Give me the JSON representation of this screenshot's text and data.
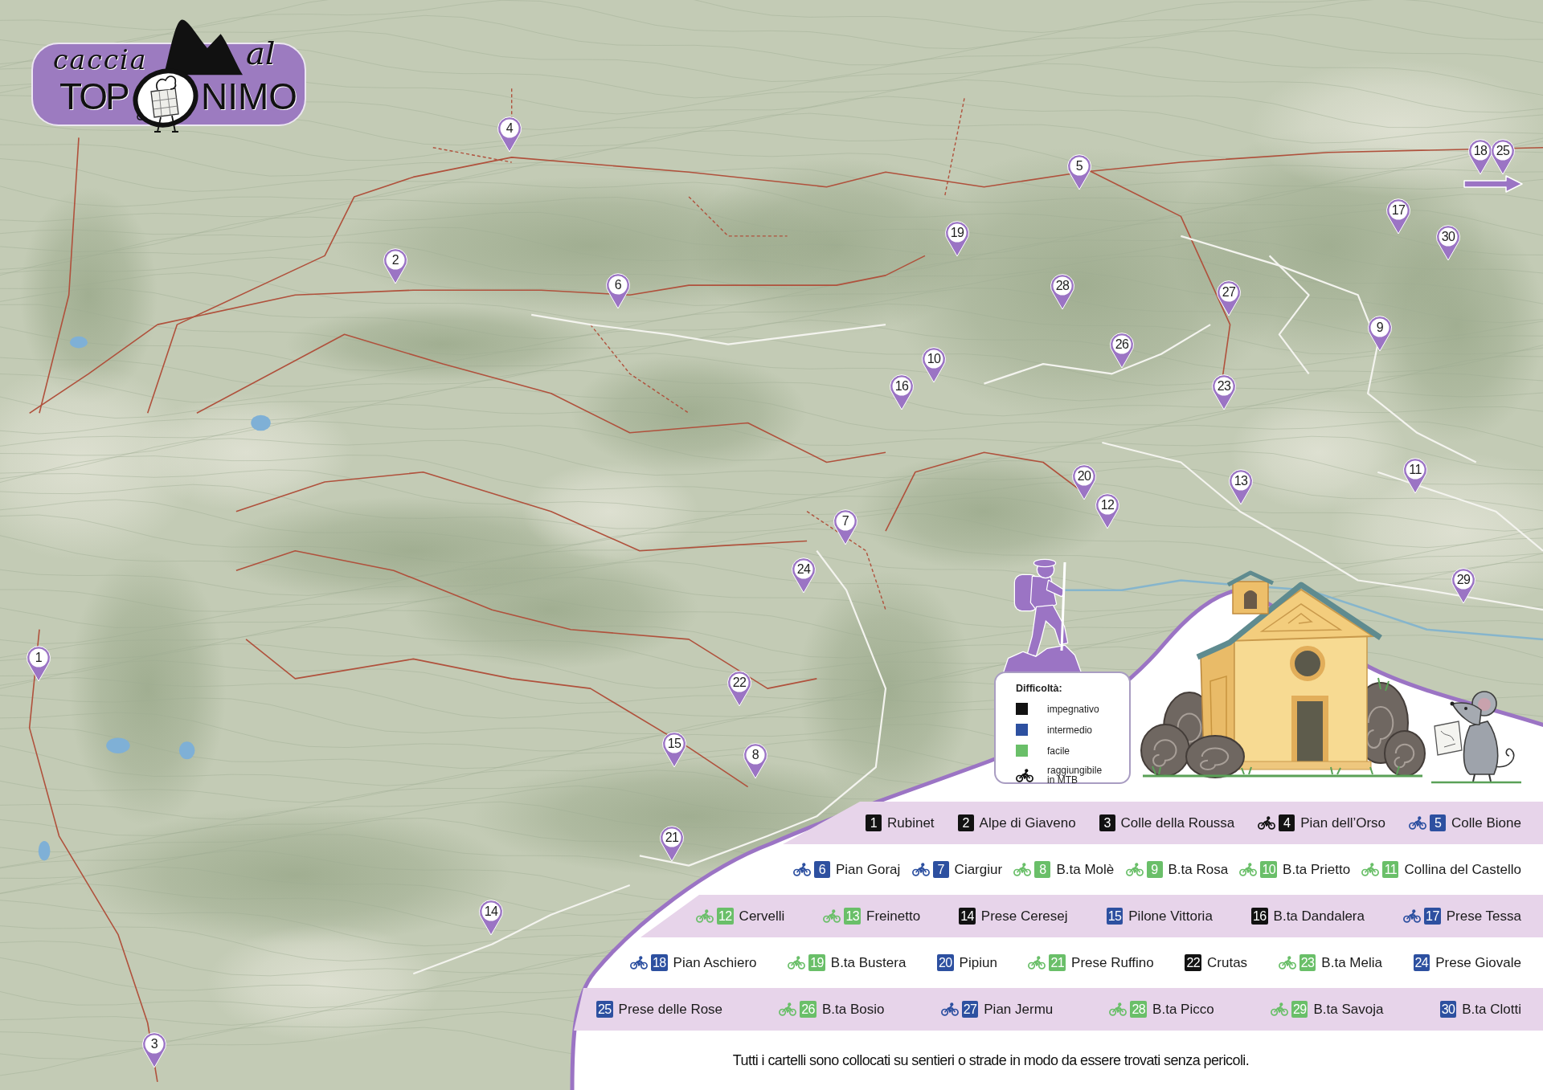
{
  "logo": {
    "word_1": "caccia",
    "word_2": "al",
    "word_3": "TOP",
    "word_4": "NIMO"
  },
  "map": {
    "markers": [
      {
        "number": "1"
      },
      {
        "number": "2"
      },
      {
        "number": "3"
      },
      {
        "number": "4"
      },
      {
        "number": "5"
      },
      {
        "number": "6"
      },
      {
        "number": "7"
      },
      {
        "number": "8"
      },
      {
        "number": "9"
      },
      {
        "number": "10"
      },
      {
        "number": "11"
      },
      {
        "number": "12"
      },
      {
        "number": "13"
      },
      {
        "number": "14"
      },
      {
        "number": "15"
      },
      {
        "number": "16"
      },
      {
        "number": "17"
      },
      {
        "number": "18"
      },
      {
        "number": "19"
      },
      {
        "number": "20"
      },
      {
        "number": "21"
      },
      {
        "number": "22"
      },
      {
        "number": "23"
      },
      {
        "number": "24"
      },
      {
        "number": "25"
      },
      {
        "number": "26"
      },
      {
        "number": "27"
      },
      {
        "number": "28"
      },
      {
        "number": "29"
      },
      {
        "number": "30"
      }
    ]
  },
  "legend": {
    "title": "Difficoltà:",
    "items": [
      {
        "kind": "swatch",
        "color": "#121212",
        "label": "impegnativo"
      },
      {
        "kind": "swatch",
        "color": "#2d50a0",
        "label": "intermedio"
      },
      {
        "kind": "swatch",
        "color": "#6abf69",
        "label": "facile"
      },
      {
        "kind": "bike",
        "label": "raggiungibile in MTB"
      }
    ]
  },
  "places": [
    {
      "items": [
        {
          "number": "1",
          "name": "Rubinet",
          "color": "#121212",
          "mtb": false
        },
        {
          "number": "2",
          "name": "Alpe di Giaveno",
          "color": "#121212",
          "mtb": false
        },
        {
          "number": "3",
          "name": "Colle della Roussa",
          "color": "#121212",
          "mtb": false
        },
        {
          "number": "4",
          "name": "Pian dell’Orso",
          "color": "#121212",
          "mtb": true
        },
        {
          "number": "5",
          "name": "Colle Bione",
          "color": "#2d50a0",
          "mtb": true
        }
      ]
    },
    {
      "items": [
        {
          "number": "6",
          "name": "Pian Goraj",
          "color": "#2d50a0",
          "mtb": true
        },
        {
          "number": "7",
          "name": "Ciargiur",
          "color": "#2d50a0",
          "mtb": true
        },
        {
          "number": "8",
          "name": "B.ta Molè",
          "color": "#6abf69",
          "mtb": true
        },
        {
          "number": "9",
          "name": "B.ta Rosa",
          "color": "#6abf69",
          "mtb": true
        },
        {
          "number": "10",
          "name": "B.ta Prietto",
          "color": "#6abf69",
          "mtb": true
        },
        {
          "number": "11",
          "name": "Collina del Castello",
          "color": "#6abf69",
          "mtb": true
        }
      ]
    },
    {
      "items": [
        {
          "number": "12",
          "name": "Cervelli",
          "color": "#6abf69",
          "mtb": true
        },
        {
          "number": "13",
          "name": "Freinetto",
          "color": "#6abf69",
          "mtb": true
        },
        {
          "number": "14",
          "name": "Prese Ceresej",
          "color": "#121212",
          "mtb": false
        },
        {
          "number": "15",
          "name": "Pilone Vittoria",
          "color": "#2d50a0",
          "mtb": false
        },
        {
          "number": "16",
          "name": "B.ta Dandalera",
          "color": "#121212",
          "mtb": false
        },
        {
          "number": "17",
          "name": "Prese Tessa",
          "color": "#2d50a0",
          "mtb": true
        }
      ]
    },
    {
      "items": [
        {
          "number": "18",
          "name": "Pian Aschiero",
          "color": "#2d50a0",
          "mtb": true
        },
        {
          "number": "19",
          "name": "B.ta Bustera",
          "color": "#6abf69",
          "mtb": true
        },
        {
          "number": "20",
          "name": "Pipiun",
          "color": "#2d50a0",
          "mtb": false
        },
        {
          "number": "21",
          "name": "Prese Ruffino",
          "color": "#6abf69",
          "mtb": true
        },
        {
          "number": "22",
          "name": "Crutas",
          "color": "#121212",
          "mtb": false
        },
        {
          "number": "23",
          "name": "B.ta Melia",
          "color": "#6abf69",
          "mtb": true
        },
        {
          "number": "24",
          "name": "Prese Giovale",
          "color": "#2d50a0",
          "mtb": false
        }
      ]
    },
    {
      "items": [
        {
          "number": "25",
          "name": "Prese delle Rose",
          "color": "#2d50a0",
          "mtb": false
        },
        {
          "number": "26",
          "name": "B.ta Bosio",
          "color": "#6abf69",
          "mtb": true
        },
        {
          "number": "27",
          "name": "Pian Jermu",
          "color": "#2d50a0",
          "mtb": true
        },
        {
          "number": "28",
          "name": "B.ta Picco",
          "color": "#6abf69",
          "mtb": true
        },
        {
          "number": "29",
          "name": "B.ta Savoja",
          "color": "#6abf69",
          "mtb": true
        },
        {
          "number": "30",
          "name": "B.ta Clotti",
          "color": "#2d50a0",
          "mtb": false
        }
      ]
    }
  ],
  "note": "Tutti i cartelli sono collocati su sentieri o strade in modo da essere trovati senza pericoli."
}
